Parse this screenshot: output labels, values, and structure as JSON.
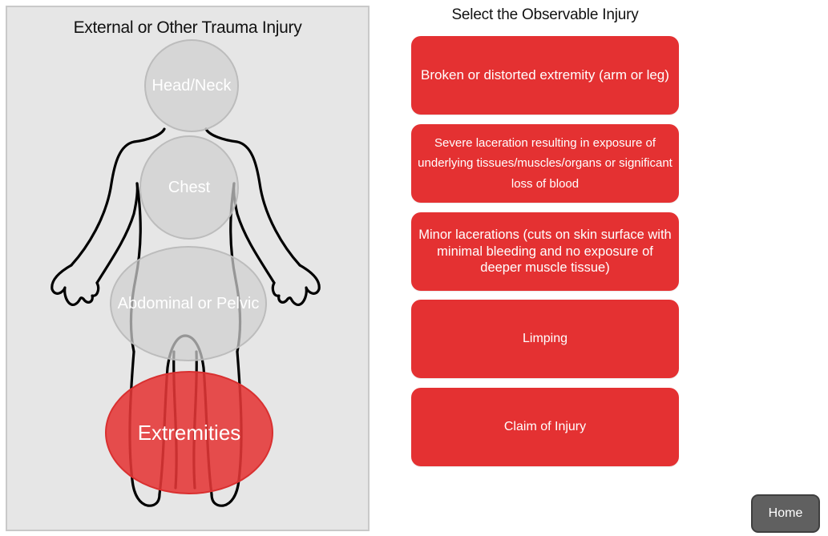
{
  "left_panel": {
    "title": "External or Other Trauma Injury",
    "regions": {
      "head_neck": "Head/Neck",
      "chest": "Chest",
      "abdominal_pelvic": "Abdominal or Pelvic",
      "extremities": "Extremities"
    },
    "selected_region": "extremities"
  },
  "right_panel": {
    "title": "Select the Observable Injury",
    "options": [
      "Broken or distorted extremity (arm or leg)",
      "Severe laceration resulting in exposure of underlying tissues/muscles/organs or significant loss of blood",
      "Minor lacerations (cuts on skin surface with minimal bleeding and no exposure of deeper muscle tissue)",
      "Limping",
      "Claim of Injury"
    ]
  },
  "home_button": "Home",
  "colors": {
    "option_red": "#e43132",
    "selected_red": "#e53737",
    "region_grey": "#d0d0d0",
    "panel_bg": "#e6e6e6",
    "home_bg": "#606060"
  }
}
